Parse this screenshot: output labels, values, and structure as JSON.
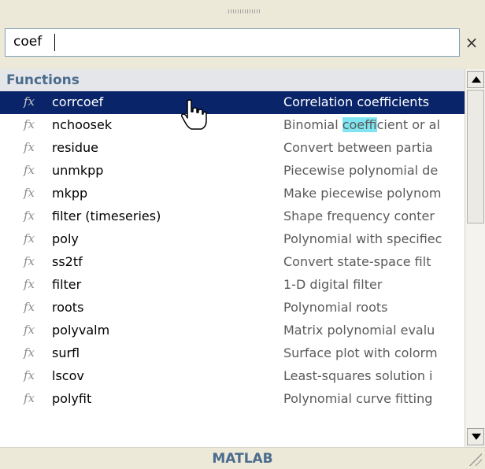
{
  "search": {
    "value": "coef",
    "clear_label": "×"
  },
  "group": {
    "label": "Functions"
  },
  "fx_label": "fx",
  "items": [
    {
      "name": "corrcoef",
      "desc": "Correlation coefficients"
    },
    {
      "name": "nchoosek",
      "desc_before": "Binomial ",
      "desc_hl": "coef",
      "desc_after": "ficient or al"
    },
    {
      "name": "residue",
      "desc": "Convert between partia"
    },
    {
      "name": "unmkpp",
      "desc": "Piecewise polynomial de"
    },
    {
      "name": "mkpp",
      "desc": "Make piecewise polynom"
    },
    {
      "name": "filter (timeseries)",
      "desc": "Shape frequency conter"
    },
    {
      "name": "poly",
      "desc": "Polynomial with specifiec"
    },
    {
      "name": "ss2tf",
      "desc": "Convert state-space filt"
    },
    {
      "name": "filter",
      "desc": "1-D digital filter"
    },
    {
      "name": "roots",
      "desc": "Polynomial roots"
    },
    {
      "name": "polyvalm",
      "desc": "Matrix polynomial evalu"
    },
    {
      "name": "surfl",
      "desc": "Surface plot with colorm"
    },
    {
      "name": "lscov",
      "desc": "Least-squares solution i"
    },
    {
      "name": "polyfit",
      "desc": "Polynomial curve fitting"
    }
  ],
  "footer": {
    "label": "MATLAB"
  },
  "colors": {
    "selection": "#0a246a",
    "highlight": "#7fe5f0",
    "header_text": "#4b6c8d"
  }
}
